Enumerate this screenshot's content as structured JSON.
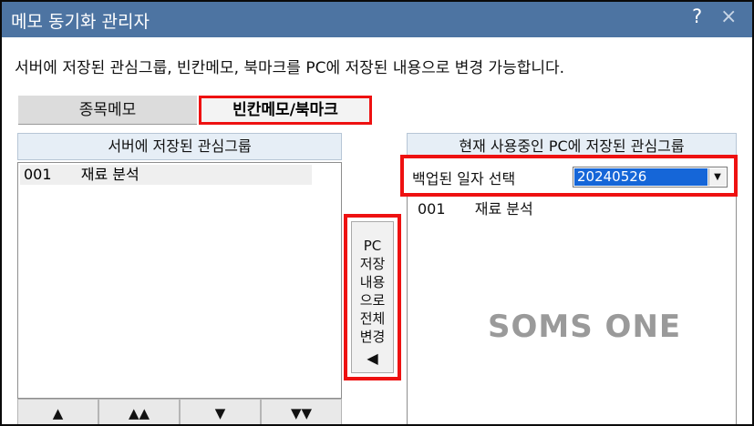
{
  "window": {
    "title": "메모 동기화 관리자",
    "help_glyph": "?",
    "close_glyph": "×"
  },
  "description": "서버에 저장된 관심그룹, 빈칸메모, 북마크를 PC에 저장된 내용으로 변경 가능합니다.",
  "tabs": [
    {
      "label": "종목메모",
      "active": false
    },
    {
      "label": "빈칸메모/북마크",
      "active": true
    }
  ],
  "left_panel": {
    "header": "서버에 저장된 관심그룹",
    "items": [
      {
        "code": "001",
        "name": "재료 분석"
      }
    ],
    "nav_buttons": [
      "▲",
      "▲▲",
      "▼",
      "▼▼"
    ]
  },
  "transfer_button": {
    "lines": [
      "PC",
      "저장",
      "내용",
      "으로",
      "전체",
      "변경"
    ],
    "arrow": "◀"
  },
  "right_panel": {
    "header": "현재 사용중인 PC에 저장된 관심그룹",
    "backup_label": "백업된 일자 선택",
    "backup_date": "20240526",
    "items": [
      {
        "code": "001",
        "name": "재료 분석"
      }
    ]
  },
  "watermark": "SOMS ONE",
  "colors": {
    "titlebar": "#4d74a2",
    "highlight_border": "#ee1111",
    "selection": "#1566d8",
    "header_bg": "#e6eef6"
  }
}
